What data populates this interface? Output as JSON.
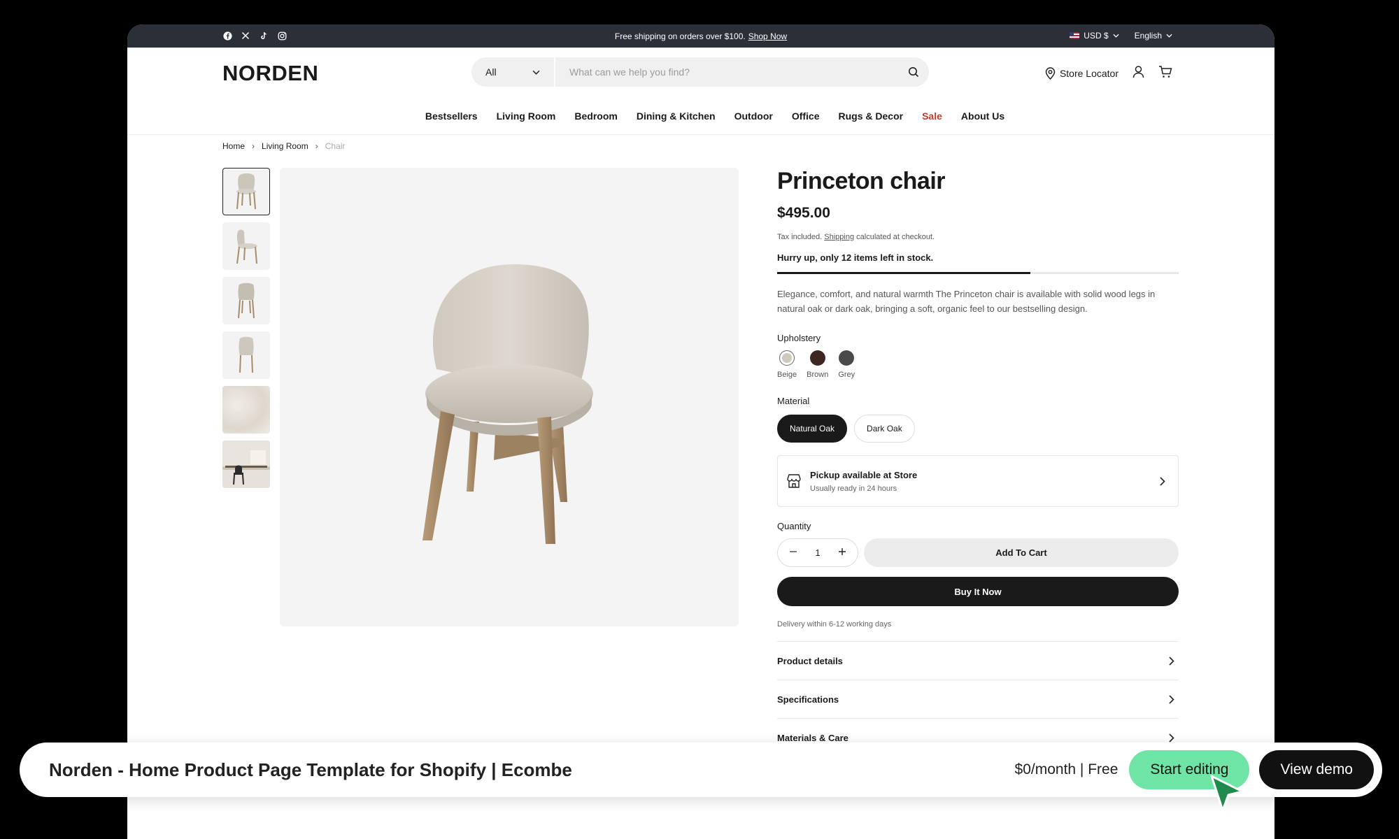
{
  "announcement": {
    "text": "Free shipping on orders over $100.",
    "link": "Shop Now",
    "currency": "USD $",
    "language": "English",
    "socials": [
      "facebook-icon",
      "x-icon",
      "tiktok-icon",
      "instagram-icon"
    ]
  },
  "header": {
    "logo": "NORDEN",
    "search_category": "All",
    "search_placeholder": "What can we help you find?",
    "store_locator": "Store Locator"
  },
  "nav": {
    "items": [
      "Bestsellers",
      "Living Room",
      "Bedroom",
      "Dining & Kitchen",
      "Outdoor",
      "Office",
      "Rugs & Decor",
      "Sale",
      "About Us"
    ]
  },
  "breadcrumb": [
    "Home",
    "Living Room",
    "Chair"
  ],
  "product": {
    "title": "Princeton chair",
    "price": "$495.00",
    "tax_prefix": "Tax included.",
    "tax_link": "Shipping",
    "tax_suffix": "calculated at checkout.",
    "stock_text": "Hurry up, only 12 items left in stock.",
    "stock_fraction": 0.63,
    "description": "Elegance, comfort, and natural warmth The Princeton chair is available with solid wood legs in natural oak or dark oak, bringing a soft, organic feel to our bestselling design.",
    "upholstery_label": "Upholstery",
    "upholstery": [
      {
        "name": "Beige",
        "color": "#cfc8bc",
        "selected": true
      },
      {
        "name": "Brown",
        "color": "#3e2723",
        "selected": false
      },
      {
        "name": "Grey",
        "color": "#4a4a4a",
        "selected": false
      }
    ],
    "material_label": "Material",
    "materials": [
      {
        "name": "Natural Oak",
        "selected": true
      },
      {
        "name": "Dark Oak",
        "selected": false
      }
    ],
    "pickup_title": "Pickup available at Store",
    "pickup_sub": "Usually ready in 24 hours",
    "quantity_label": "Quantity",
    "quantity": "1",
    "add_to_cart": "Add To Cart",
    "buy_now": "Buy It Now",
    "delivery": "Delivery within 6-12 working days",
    "accordion": [
      "Product details",
      "Specifications",
      "Materials & Care"
    ]
  },
  "promo": {
    "title": "Norden - Home Product Page Template for Shopify | Ecombe",
    "price": "$0/month | Free",
    "start_editing": "Start editing",
    "view_demo": "View demo"
  },
  "colors": {
    "accent_green": "#6ee5a4",
    "sale_red": "#c0392b",
    "dark": "#1a1a1a"
  }
}
